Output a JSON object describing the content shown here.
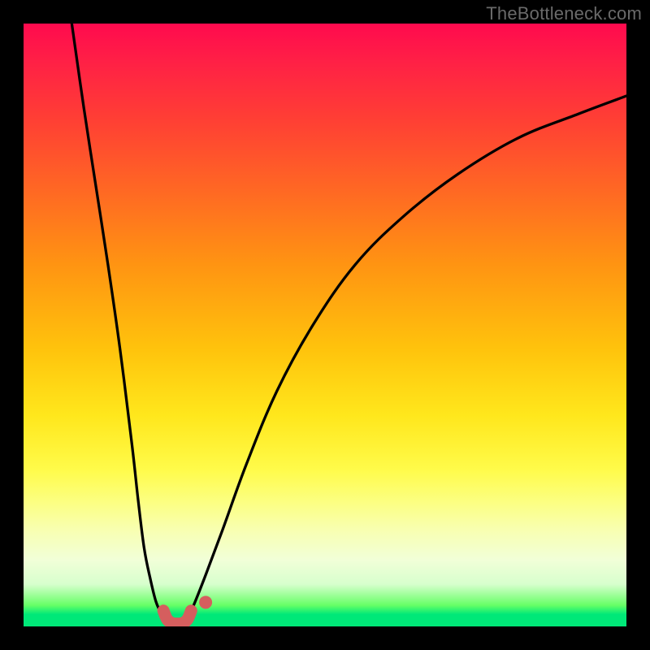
{
  "watermark": {
    "text": "TheBottleneck.com"
  },
  "chart_data": {
    "type": "line",
    "title": "",
    "xlabel": "",
    "ylabel": "",
    "xlim": [
      0,
      100
    ],
    "ylim": [
      0,
      100
    ],
    "grid": false,
    "legend": false,
    "series": [
      {
        "name": "left-branch",
        "x": [
          8,
          10,
          12,
          14,
          16,
          18,
          19,
          20,
          21,
          22,
          23,
          24
        ],
        "y": [
          100,
          86,
          73,
          60,
          46,
          30,
          21,
          13,
          8,
          4,
          2,
          1
        ],
        "color": "#000000"
      },
      {
        "name": "right-branch",
        "x": [
          27,
          28,
          30,
          33,
          37,
          42,
          48,
          55,
          63,
          72,
          82,
          92,
          100
        ],
        "y": [
          1,
          3,
          8,
          16,
          27,
          39,
          50,
          60,
          68,
          75,
          81,
          85,
          88
        ],
        "color": "#000000"
      },
      {
        "name": "valley-arc",
        "x": [
          23.2,
          23.8,
          24.6,
          25.5,
          26.4,
          27.2,
          27.8
        ],
        "y": [
          2.6,
          1.2,
          0.55,
          0.45,
          0.55,
          1.2,
          2.6
        ],
        "color": "#d55e5e"
      },
      {
        "name": "valley-dot",
        "x": [
          30.2
        ],
        "y": [
          4.0
        ],
        "color": "#d55e5e"
      }
    ],
    "background": {
      "type": "vertical-gradient",
      "stops": [
        {
          "pos": 0.0,
          "color": "#ff0a4e"
        },
        {
          "pos": 0.4,
          "color": "#ff9412"
        },
        {
          "pos": 0.74,
          "color": "#fffb4a"
        },
        {
          "pos": 0.96,
          "color": "#66ff66"
        },
        {
          "pos": 1.0,
          "color": "#00e878"
        }
      ]
    }
  }
}
